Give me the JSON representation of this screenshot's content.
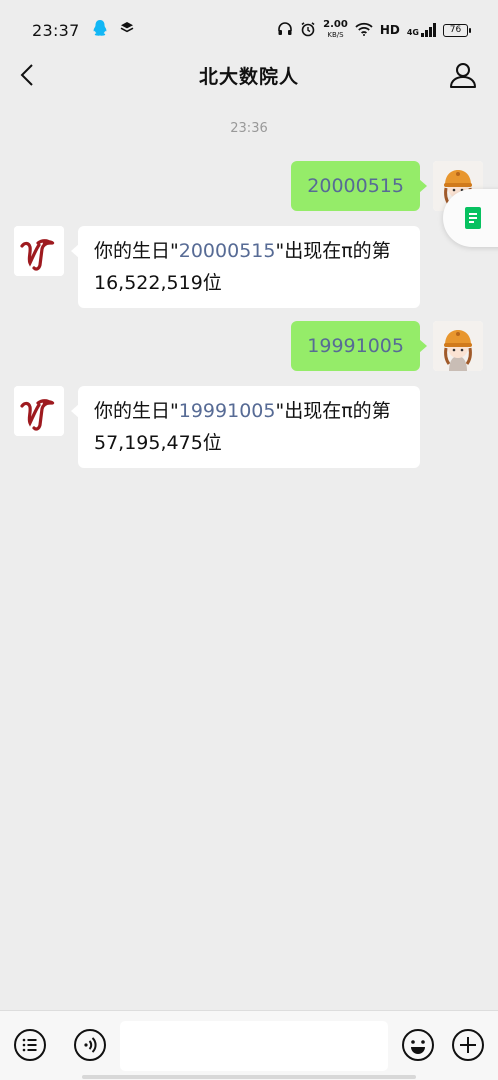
{
  "status_bar": {
    "time": "23:37",
    "net_speed_value": "2.00",
    "net_speed_unit": "KB/S",
    "hd_label": "HD",
    "network_label": "4G",
    "battery": "76"
  },
  "header": {
    "title": "北大数院人"
  },
  "chat": {
    "timestamp": "23:36",
    "messages": [
      {
        "sender": "me",
        "text": "20000515"
      },
      {
        "sender": "other",
        "prefix": "你的生日\"",
        "highlight": "20000515",
        "suffix": "\"出现在π的第16,522,519位"
      },
      {
        "sender": "me",
        "text": "19991005"
      },
      {
        "sender": "other",
        "prefix": "你的生日\"",
        "highlight": "19991005",
        "suffix": "\"出现在π的第57,195,475位"
      }
    ]
  },
  "input_bar": {
    "placeholder": ""
  },
  "colors": {
    "background": "#ededed",
    "my_bubble": "#95ec69",
    "link": "#576b95",
    "accent_green": "#07c160",
    "logo_red": "#9e1a1f"
  }
}
